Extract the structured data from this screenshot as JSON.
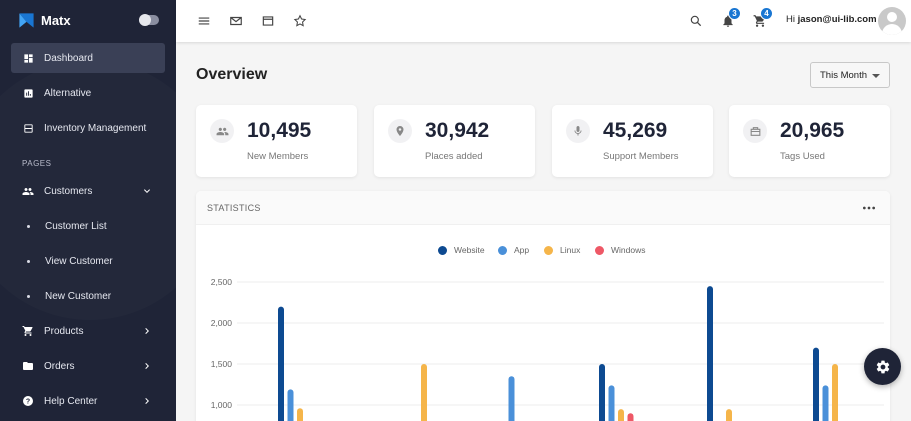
{
  "sidebar": {
    "brand": "Matx",
    "section_label": "PAGES",
    "items": [
      {
        "label": "Dashboard",
        "icon": "dashboard-icon",
        "active": true
      },
      {
        "label": "Alternative",
        "icon": "chart-icon"
      },
      {
        "label": "Inventory Management",
        "icon": "inventory-icon"
      },
      {
        "label": "Customers",
        "icon": "people-icon",
        "expanded": true
      },
      {
        "label": "Customer List"
      },
      {
        "label": "View Customer"
      },
      {
        "label": "New Customer"
      },
      {
        "label": "Products",
        "icon": "cart-icon"
      },
      {
        "label": "Orders",
        "icon": "folder-icon"
      },
      {
        "label": "Help Center",
        "icon": "help-icon"
      }
    ]
  },
  "topbar": {
    "notifications_count": "3",
    "cart_count": "4",
    "greeting_prefix": "Hi",
    "username": "jason@ui-lib.com"
  },
  "main": {
    "title": "Overview",
    "period_select": "This Month",
    "stats": [
      {
        "value": "10,495",
        "label": "New Members",
        "icon": "people-icon"
      },
      {
        "value": "30,942",
        "label": "Places added",
        "icon": "location-pin-icon"
      },
      {
        "value": "45,269",
        "label": "Support Members",
        "icon": "microphone-icon"
      },
      {
        "value": "20,965",
        "label": "Tags Used",
        "icon": "tag-icon"
      }
    ],
    "statistics_title": "STATISTICS"
  },
  "colors": {
    "sidebar_bg": "#1f2437",
    "website": "#0d4a91",
    "app": "#4a90d9",
    "linux": "#f5b54a",
    "windows": "#ee5866"
  },
  "chart_data": {
    "type": "bar",
    "series": [
      {
        "name": "Website",
        "color": "#0d4a91",
        "values": [
          2200,
          null,
          null,
          1500,
          2450,
          1700
        ]
      },
      {
        "name": "App",
        "color": "#4a90d9",
        "values": [
          1190,
          null,
          1350,
          1240,
          null,
          1240
        ]
      },
      {
        "name": "Linux",
        "color": "#f5b54a",
        "values": [
          960,
          1500,
          null,
          950,
          950,
          1500
        ]
      },
      {
        "name": "Windows",
        "color": "#ee5866",
        "values": [
          null,
          null,
          null,
          900,
          null,
          null
        ]
      }
    ],
    "y_ticks": [
      "2,500",
      "2,000",
      "1,500",
      "1,000"
    ],
    "ylim": [
      1000,
      2500
    ],
    "grid": true,
    "legend": "top-center"
  }
}
